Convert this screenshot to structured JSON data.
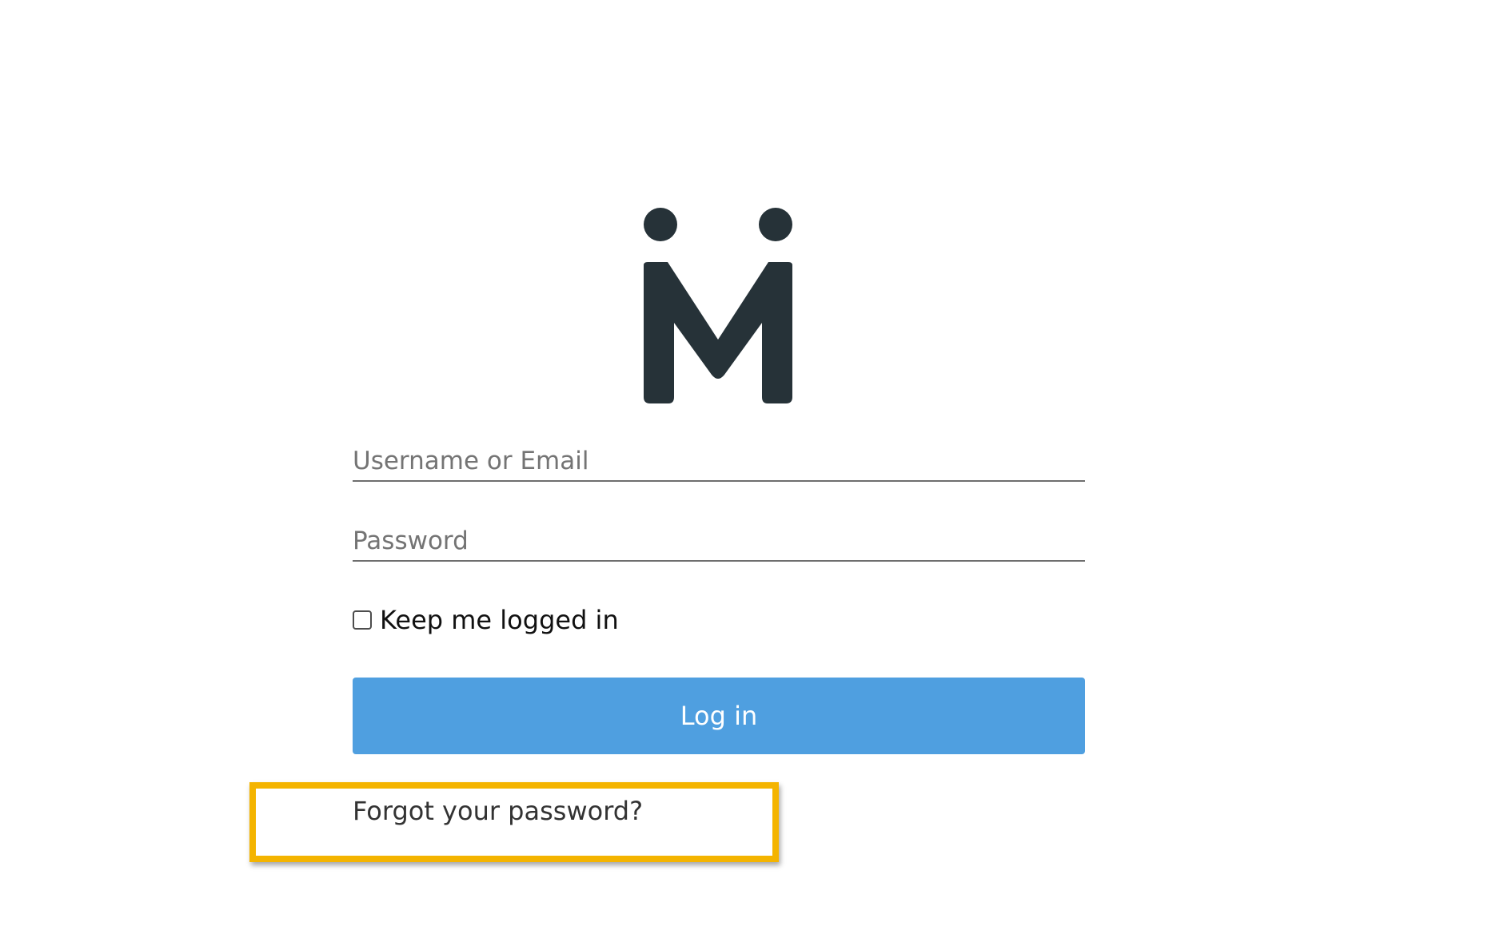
{
  "login": {
    "username_placeholder": "Username or Email",
    "password_placeholder": "Password",
    "remember_label": "Keep me logged in",
    "login_label": "Log in",
    "forgot_label": "Forgot your password?"
  },
  "colors": {
    "logo": "#263238",
    "button": "#4f9fe0",
    "highlight": "#f4b400"
  },
  "icons": {
    "logo": "m-logo-icon"
  }
}
